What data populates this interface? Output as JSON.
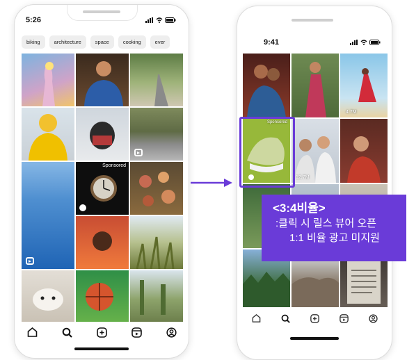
{
  "left_phone": {
    "status_time": "5:26",
    "chips": [
      "biking",
      "architecture",
      "space",
      "cooking",
      "ever"
    ],
    "sponsored_label": "Sponsored",
    "nav_items": [
      "home-icon",
      "search-icon",
      "create-icon",
      "reels-icon",
      "profile-icon"
    ]
  },
  "right_phone": {
    "status_time": "9:41",
    "tile_1_views": "4.7M",
    "tile_2_views": "12.7M",
    "sponsored_label": "Sponsored",
    "nav_items": [
      "home-icon",
      "search-icon",
      "create-icon",
      "reels-icon",
      "profile-icon"
    ]
  },
  "callout": {
    "title": "<3:4비율>",
    "line1": ":클릭 시 릴스 뷰어 오픈",
    "line2": "1:1 비율 광고 미지원"
  },
  "colors": {
    "accent": "#6a3bd8",
    "arrow": "#6a3bd8"
  }
}
